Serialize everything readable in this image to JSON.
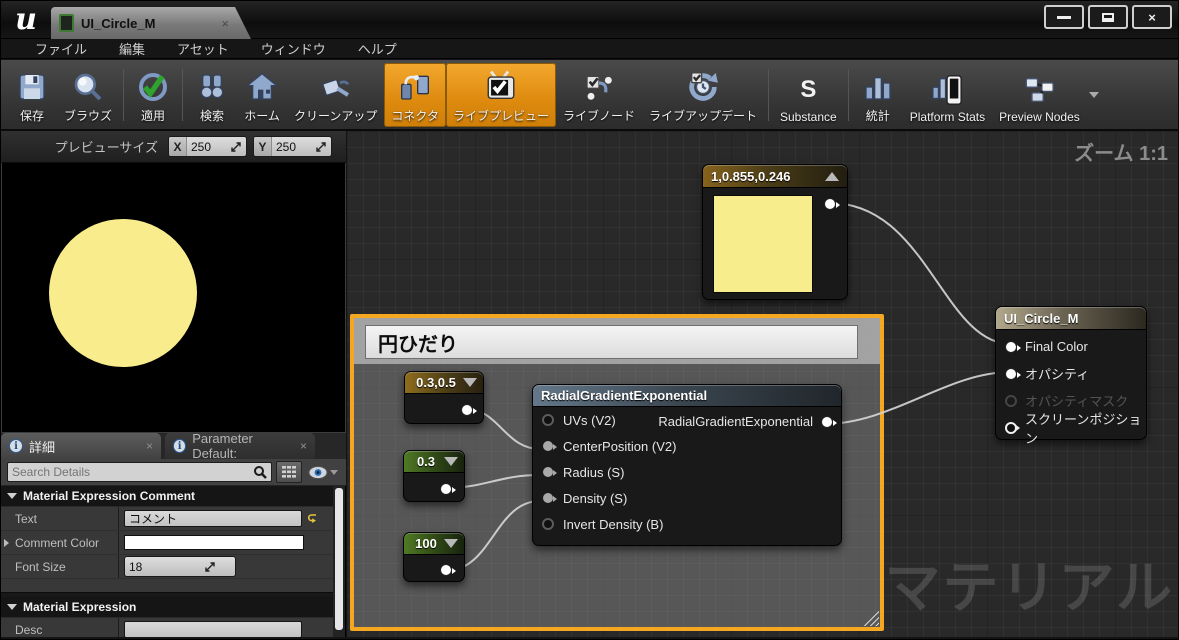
{
  "titlebar": {
    "logo": "u",
    "tab_title": "UI_Circle_M",
    "tab_close": "×",
    "info_glyph": "i"
  },
  "menubar": {
    "items": [
      "ファイル",
      "編集",
      "アセット",
      "ウィンドウ",
      "ヘルプ"
    ]
  },
  "toolbar": {
    "active_color": "#E8920D",
    "substance_glyph": "S",
    "buttons": [
      {
        "label": "保存",
        "active": false
      },
      {
        "label": "ブラウズ",
        "active": false
      },
      {
        "label": "適用",
        "active": false
      },
      {
        "label": "検索",
        "active": false
      },
      {
        "label": "ホーム",
        "active": false
      },
      {
        "label": "クリーンアップ",
        "active": false
      },
      {
        "label": "コネクタ",
        "active": true
      },
      {
        "label": "ライブプレビュー",
        "active": true
      },
      {
        "label": "ライブノード",
        "active": false
      },
      {
        "label": "ライブアップデート",
        "active": false
      },
      {
        "label": "Substance",
        "active": false
      },
      {
        "label": "統計",
        "active": false
      },
      {
        "label": "Platform Stats",
        "active": false
      },
      {
        "label": "Preview Nodes",
        "active": false
      }
    ]
  },
  "preview": {
    "size_label": "プレビューサイズ",
    "x_label": "X",
    "x_value": "250",
    "y_label": "Y",
    "y_value": "250",
    "circle_color": "#F9EC8C",
    "background": "#000000"
  },
  "details": {
    "tab_details": "詳細",
    "tab_parameters": "Parameter Default:",
    "tab_close": "×",
    "search_placeholder": "Search Details",
    "section_comment": {
      "title": "Material Expression Comment",
      "text_label": "Text",
      "text_value": "コメント",
      "color_label": "Comment Color",
      "color_value": "#FFFFFF",
      "font_label": "Font Size",
      "font_value": "18"
    },
    "section_expression": {
      "title": "Material Expression",
      "desc_label": "Desc",
      "desc_value": ""
    }
  },
  "graph": {
    "zoom_label": "ズーム 1:1",
    "watermark": "マテリアル",
    "comment": {
      "title": "円ひだり",
      "border_color": "#F6A721"
    },
    "const_color_node": {
      "title": "1,0.855,0.246",
      "preview_color": "#F8ED8D"
    },
    "const2_node": {
      "title": "0.3,0.5"
    },
    "const_radius_node": {
      "title": "0.3"
    },
    "const_density_node": {
      "title": "100"
    },
    "rge_node": {
      "title": "RadialGradientExponential",
      "inputs": [
        "UVs (V2)",
        "CenterPosition (V2)",
        "Radius (S)",
        "Density (S)",
        "Invert Density (B)"
      ],
      "output_label": "RadialGradientExponential"
    },
    "output_node": {
      "title": "UI_Circle_M",
      "pins": [
        "Final Color",
        "オパシティ",
        "オパシティマスク",
        "スクリーンポジション"
      ]
    }
  }
}
